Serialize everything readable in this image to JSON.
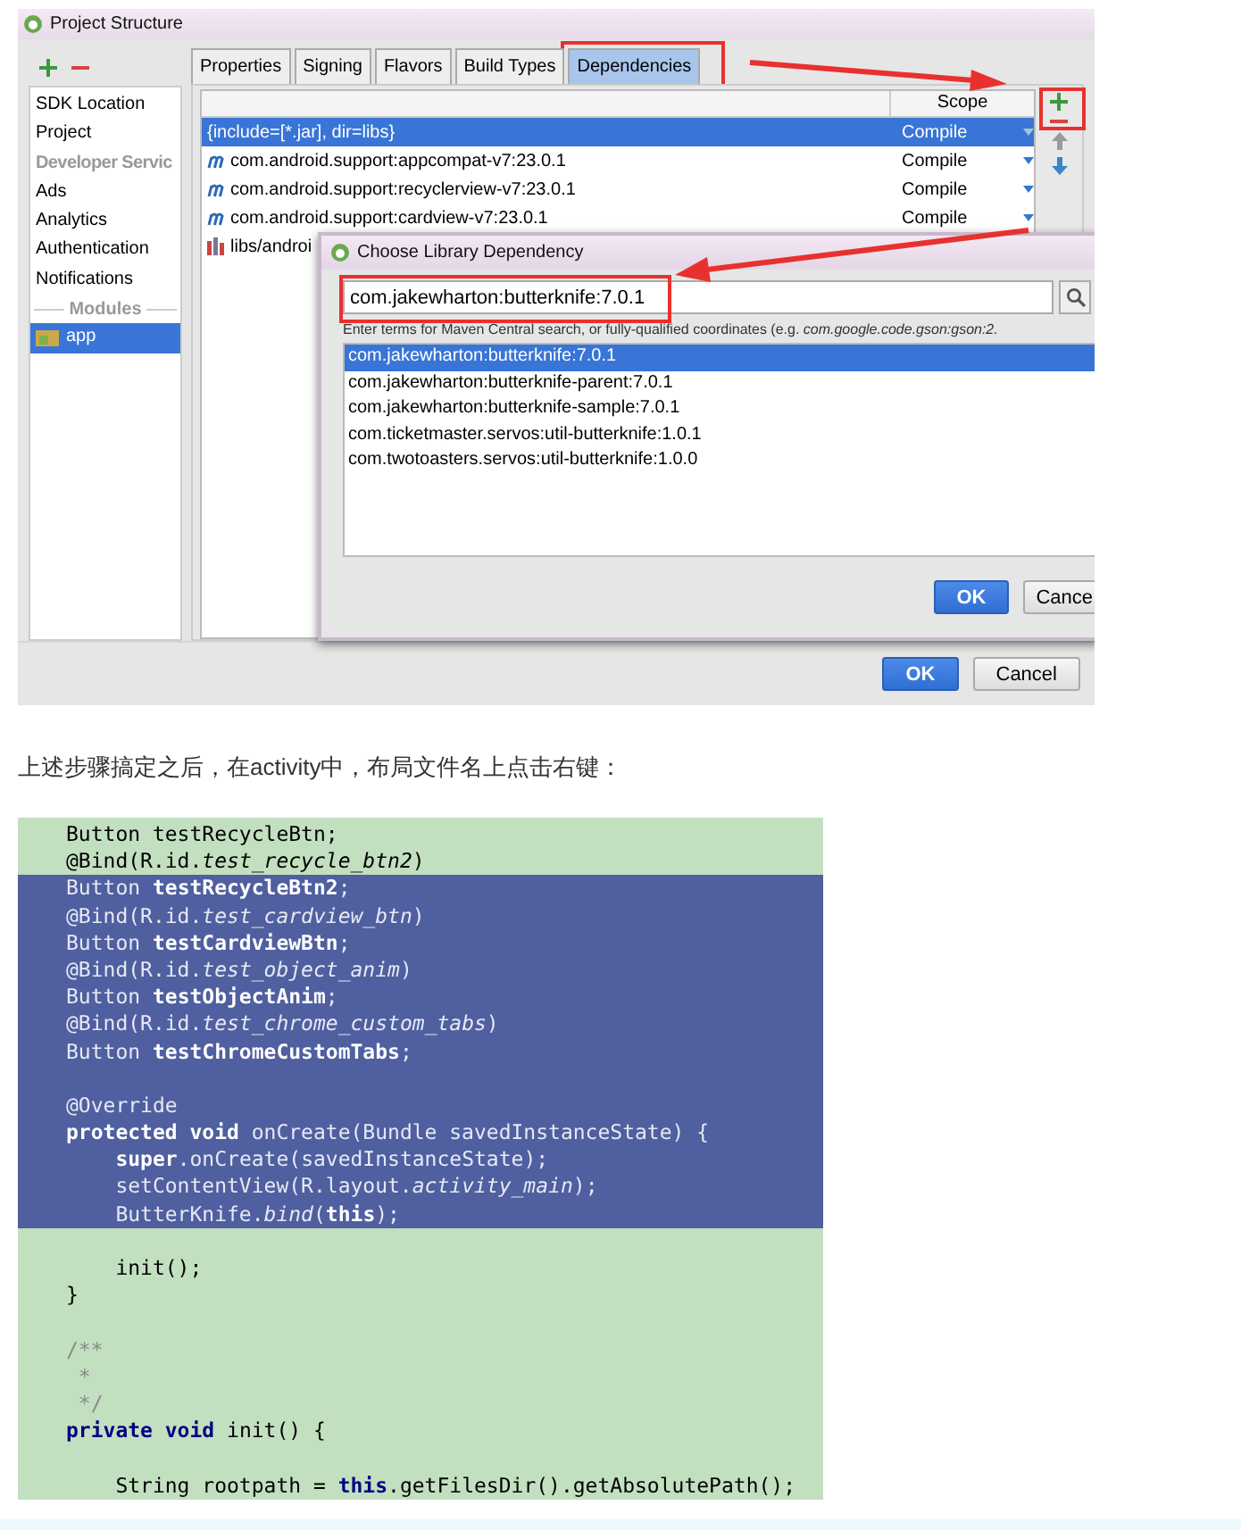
{
  "window": {
    "title": "Project Structure"
  },
  "sidebar": {
    "items": [
      {
        "label": "SDK Location",
        "kind": "item",
        "selected": false
      },
      {
        "label": "Project",
        "kind": "item",
        "selected": false
      },
      {
        "label": "Developer Servic",
        "kind": "header"
      },
      {
        "label": "Ads",
        "kind": "item",
        "selected": false
      },
      {
        "label": "Analytics",
        "kind": "item",
        "selected": false
      },
      {
        "label": "Authentication",
        "kind": "item",
        "selected": false
      },
      {
        "label": "Notifications",
        "kind": "item",
        "selected": false
      },
      {
        "label": "Modules",
        "kind": "separator"
      },
      {
        "label": "app",
        "kind": "module",
        "selected": true
      }
    ]
  },
  "tabs": [
    {
      "label": "Properties",
      "selected": false
    },
    {
      "label": "Signing",
      "selected": false
    },
    {
      "label": "Flavors",
      "selected": false
    },
    {
      "label": "Build Types",
      "selected": false
    },
    {
      "label": "Dependencies",
      "selected": true
    }
  ],
  "table": {
    "scope_header": "Scope",
    "rows": [
      {
        "kind": "jar",
        "name": "{include=[*.jar], dir=libs}",
        "scope": "Compile",
        "selected": true
      },
      {
        "kind": "maven",
        "name": "com.android.support:appcompat-v7:23.0.1",
        "scope": "Compile",
        "selected": false
      },
      {
        "kind": "maven",
        "name": "com.android.support:recyclerview-v7:23.0.1",
        "scope": "Compile",
        "selected": false
      },
      {
        "kind": "maven",
        "name": "com.android.support:cardview-v7:23.0.1",
        "scope": "Compile",
        "selected": false
      },
      {
        "kind": "library",
        "name": "libs/androi",
        "selected": false
      }
    ]
  },
  "dialog": {
    "title": "Choose Library Dependency",
    "search": "com.jakewharton:butterknife:7.0.1",
    "hint": "Enter terms for Maven Central search, or fully-qualified coordinates (e.g. *com.google.code.gson:gson:2.*",
    "results": [
      {
        "label": "com.jakewharton:butterknife:7.0.1",
        "selected": true
      },
      {
        "label": "com.jakewharton:butterknife-parent:7.0.1",
        "selected": false
      },
      {
        "label": "com.jakewharton:butterknife-sample:7.0.1",
        "selected": false
      },
      {
        "label": "com.ticketmaster.servos:util-butterknife:1.0.1",
        "selected": false
      },
      {
        "label": "com.twotoasters.servos:util-butterknife:1.0.0",
        "selected": false
      }
    ],
    "buttons": [
      "OK",
      "Cance"
    ]
  },
  "footer_buttons": [
    "OK",
    "Cancel"
  ],
  "paragraph": "上述步骤搞定之后，在activity中，布局文件名上点击右键：",
  "code": {
    "lines": [
      {
        "kind": "code",
        "text": "Button testRecycleBtn;",
        "selected": false
      },
      {
        "kind": "code",
        "text": "@Bind(R.id.*test_recycle_btn2*)",
        "selected": false
      },
      {
        "kind": "code",
        "text": "Button **testRecycleBtn2**;",
        "selected": true
      },
      {
        "kind": "code",
        "text": "@Bind(R.id.*test_cardview_btn*)",
        "selected": true
      },
      {
        "kind": "code",
        "text": "Button **testCardviewBtn**;",
        "selected": true
      },
      {
        "kind": "code",
        "text": "@Bind(R.id.*test_object_anim*)",
        "selected": true
      },
      {
        "kind": "code",
        "text": "Button **testObjectAnim**;",
        "selected": true
      },
      {
        "kind": "code",
        "text": "@Bind(R.id.*test_chrome_custom_tabs*)",
        "selected": true
      },
      {
        "kind": "code",
        "text": "Button **testChromeCustomTabs**;",
        "selected": true
      },
      {
        "kind": "blank",
        "selected": true
      },
      {
        "kind": "code",
        "text": "@Override",
        "selected": true
      },
      {
        "kind": "code",
        "text": "**protected void** onCreate(Bundle savedInstanceState) {",
        "selected": true
      },
      {
        "kind": "code",
        "text": "    **super**.onCreate(savedInstanceState);",
        "selected": true
      },
      {
        "kind": "code",
        "text": "    setContentView(R.layout.*activity_main*);",
        "selected": true
      },
      {
        "kind": "code",
        "text": "    ButterKnife.*bind*(**this**);",
        "selected": true
      },
      {
        "kind": "blank",
        "selected": false
      },
      {
        "kind": "code",
        "text": "    init();",
        "selected": false
      },
      {
        "kind": "code",
        "text": "}",
        "selected": false
      },
      {
        "kind": "blank",
        "selected": false
      },
      {
        "kind": "comment",
        "text": "/**",
        "selected": false
      },
      {
        "kind": "comment",
        "text": " *",
        "selected": false
      },
      {
        "kind": "comment",
        "text": " */",
        "selected": false
      },
      {
        "kind": "code",
        "text": "**private void** init() {",
        "selected": false
      },
      {
        "kind": "blank",
        "selected": false
      },
      {
        "kind": "code",
        "text": "    String rootpath = **this**.getFilesDir().getAbsolutePath();",
        "selected": false
      }
    ]
  }
}
